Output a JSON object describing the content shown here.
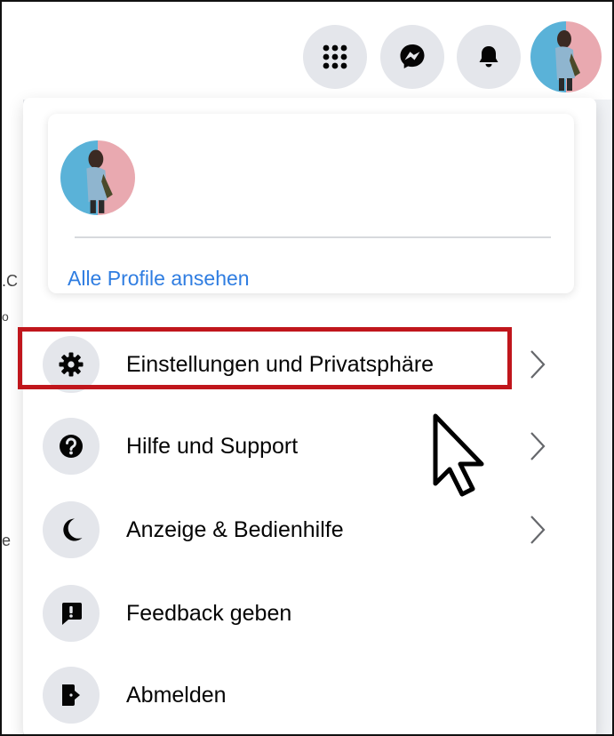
{
  "topbar": {
    "buttons": [
      {
        "name": "menu-grid",
        "icon": "apps-grid-icon"
      },
      {
        "name": "messenger",
        "icon": "messenger-icon"
      },
      {
        "name": "notifications",
        "icon": "bell-icon"
      },
      {
        "name": "account",
        "icon": "avatar"
      }
    ]
  },
  "left_fragments": [
    ".C",
    "o",
    "e"
  ],
  "profile_card": {
    "link_label": "Alle Profile ansehen"
  },
  "menu": {
    "items": [
      {
        "label": "Einstellungen und Privatsphäre",
        "icon": "gear-icon",
        "has_chevron": true,
        "highlighted": true
      },
      {
        "label": "Hilfe und Support",
        "icon": "help-icon",
        "has_chevron": true
      },
      {
        "label": "Anzeige & Bedienhilfe",
        "icon": "moon-icon",
        "has_chevron": true
      },
      {
        "label": "Feedback geben",
        "icon": "feedback-icon",
        "has_chevron": false
      },
      {
        "label": "Abmelden",
        "icon": "logout-icon",
        "has_chevron": false
      }
    ]
  },
  "colors": {
    "link": "#2f7de1",
    "highlight_border": "#c0161c",
    "icon_bg": "#e4e6eb"
  }
}
